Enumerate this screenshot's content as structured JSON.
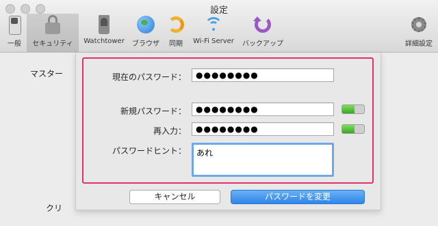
{
  "window": {
    "title": "設定"
  },
  "toolbar": {
    "items": [
      {
        "label": "一般",
        "icon": "switch-icon"
      },
      {
        "label": "セキュリティ",
        "icon": "lock-icon",
        "active": true
      },
      {
        "label": "Watchtower",
        "icon": "watchtower-icon"
      },
      {
        "label": "ブラウザ",
        "icon": "globe-icon"
      },
      {
        "label": "同期",
        "icon": "sync-icon"
      },
      {
        "label": "Wi-Fi Server",
        "icon": "wifi-icon"
      },
      {
        "label": "バックアップ",
        "icon": "backup-icon"
      },
      {
        "label": "詳細設定",
        "icon": "gear-icon"
      }
    ]
  },
  "background": {
    "master_label": "マスター",
    "cli_label": "クリ"
  },
  "sheet": {
    "current_password_label": "現在のパスワード：",
    "current_password_value": "●●●●●●●●",
    "new_password_label": "新規パスワード：",
    "new_password_value": "●●●●●●●●",
    "reenter_label": "再入力：",
    "reenter_value": "●●●●●●●●",
    "hint_label": "パスワードヒント：",
    "hint_value": "あれ",
    "cancel_button": "キャンセル",
    "change_button": "パスワードを変更",
    "strength_new": 0.55,
    "strength_reenter": 0.55
  },
  "colors": {
    "highlight": "#e0306b",
    "primary_button": "#2f86ea",
    "meter_fill": "#3ca52a"
  }
}
